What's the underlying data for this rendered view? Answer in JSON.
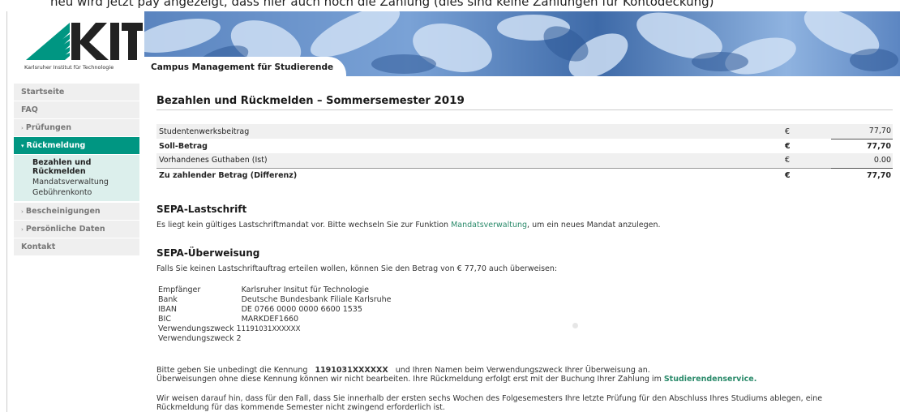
{
  "top_fragment": "neu wird jetzt pay angezeigt, dass hier auch noch die Zahlung (dies sind keine Zahlungen für Kontodeckung)",
  "logo": {
    "wordmark": "KIT",
    "subtitle": "Karlsruher Institut für Technologie",
    "color": "#009682"
  },
  "banner": {
    "tab_label": "Campus Management für Studierende"
  },
  "sidebar": {
    "items": [
      {
        "label": "Startseite",
        "arrow": ""
      },
      {
        "label": "FAQ",
        "arrow": ""
      },
      {
        "label": "Prüfungen",
        "arrow": "›"
      },
      {
        "label": "Rückmeldung",
        "arrow": "▾"
      },
      {
        "label": "Bescheinigungen",
        "arrow": "›"
      },
      {
        "label": "Persönliche Daten",
        "arrow": "›"
      },
      {
        "label": "Kontakt",
        "arrow": ""
      }
    ],
    "subitems": [
      {
        "label": "Bezahlen und Rückmelden"
      },
      {
        "label": "Mandatsverwaltung"
      },
      {
        "label": "Gebührenkonto"
      }
    ]
  },
  "main": {
    "title": "Bezahlen und Rückmelden – Sommersemester",
    "year": "2019",
    "fees": [
      {
        "label": "Studentenwerksbeitrag",
        "currency": "€",
        "amount": "77,70"
      },
      {
        "label": "Soll-Betrag",
        "currency": "€",
        "amount": "77,70"
      },
      {
        "label": "Vorhandenes Guthaben (Ist)",
        "currency": "€",
        "amount": "0.00"
      },
      {
        "label": "Zu zahlender Betrag (Differenz)",
        "currency": "€",
        "amount": "77,70"
      }
    ],
    "sepa_lastschrift": {
      "heading": "SEPA-Lastschrift",
      "text_before": "Es liegt kein gültiges Lastschriftmandat vor. Bitte wechseln Sie zur Funktion ",
      "link": "Mandatsverwaltung",
      "text_after": ", um ein neues Mandat anzulegen."
    },
    "sepa_ueberweisung": {
      "heading": "SEPA-Überweisung",
      "intro": "Falls Sie keinen Lastschriftauftrag erteilen wollen, können Sie den Betrag von € 77,70 auch überweisen:",
      "bank_rows": [
        {
          "key": "Empfänger",
          "value": "Karlsruher Insitut für Technologie"
        },
        {
          "key": "Bank",
          "value": "Deutsche Bundesbank Filiale Karlsruhe"
        },
        {
          "key": "IBAN",
          "value": "DE 0766 0000 0000 6600 1535"
        },
        {
          "key": "BIC",
          "value": "MARKDEF1660"
        },
        {
          "key": "Verwendungszweck 1",
          "value": "1191031XXXXXX"
        },
        {
          "key": "Verwendungszweck 2",
          "value": ""
        }
      ],
      "note1_before": "Bitte geben Sie unbedingt die Kennung ",
      "note1_code": "1191031XXXXXX",
      "note1_after": " und Ihren Namen beim Verwendungszweck Ihrer Überweisung an.",
      "note2_before": "Überweisungen ohne diese Kennung können wir nicht bearbeiten. Ihre Rückmeldung erfolgt erst mit der Buchung Ihrer Zahlung im ",
      "note2_link": "Studierendenservice.",
      "note3_line1": "Wir weisen darauf hin, dass für den Fall, dass Sie innerhalb der ersten sechs Wochen des Folgesemesters Ihre letzte Prüfung für den Abschluss Ihres Studiums ablegen, eine",
      "note3_line2": "Rückmeldung für das kommende Semester nicht zwingend erforderlich ist."
    }
  }
}
